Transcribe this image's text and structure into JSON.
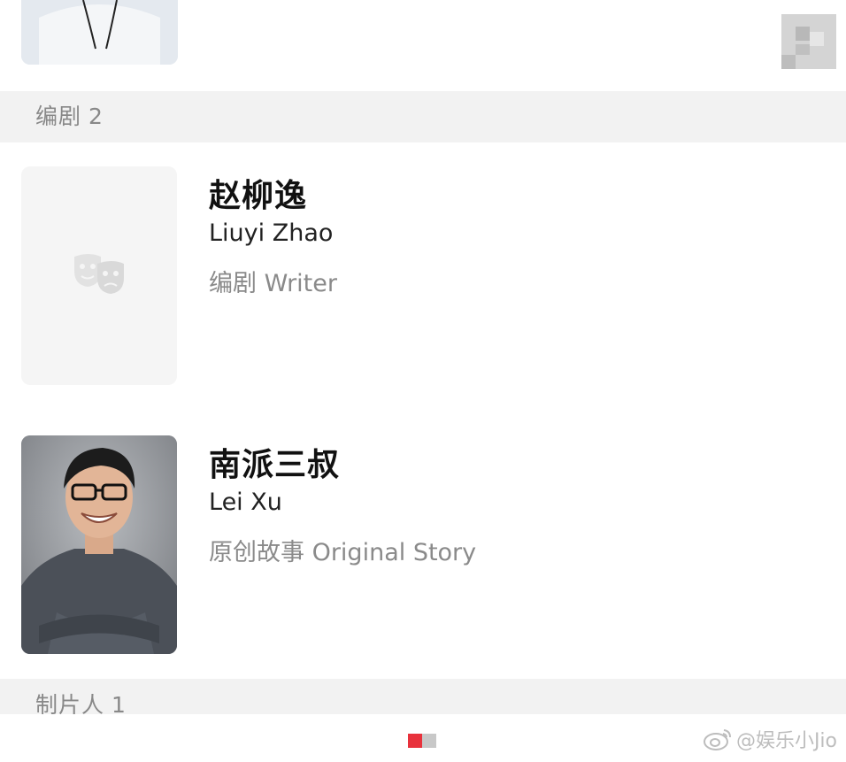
{
  "section_writers": {
    "label": "编剧",
    "count": "2"
  },
  "writers": [
    {
      "name_cn": "赵柳逸",
      "name_en": "Liuyi Zhao",
      "role": "编剧 Writer",
      "avatar": "theater-mask-icon"
    },
    {
      "name_cn": "南派三叔",
      "name_en": "Lei Xu",
      "role": "原创故事 Original Story",
      "avatar": "photo"
    }
  ],
  "section_producers": {
    "label": "制片人",
    "count": "1"
  },
  "watermark": {
    "text": "@娱乐小Jio"
  },
  "colors": {
    "accent": "#e8323c",
    "section_bg": "#f2f2f2",
    "placeholder_bg": "#f5f5f5"
  }
}
